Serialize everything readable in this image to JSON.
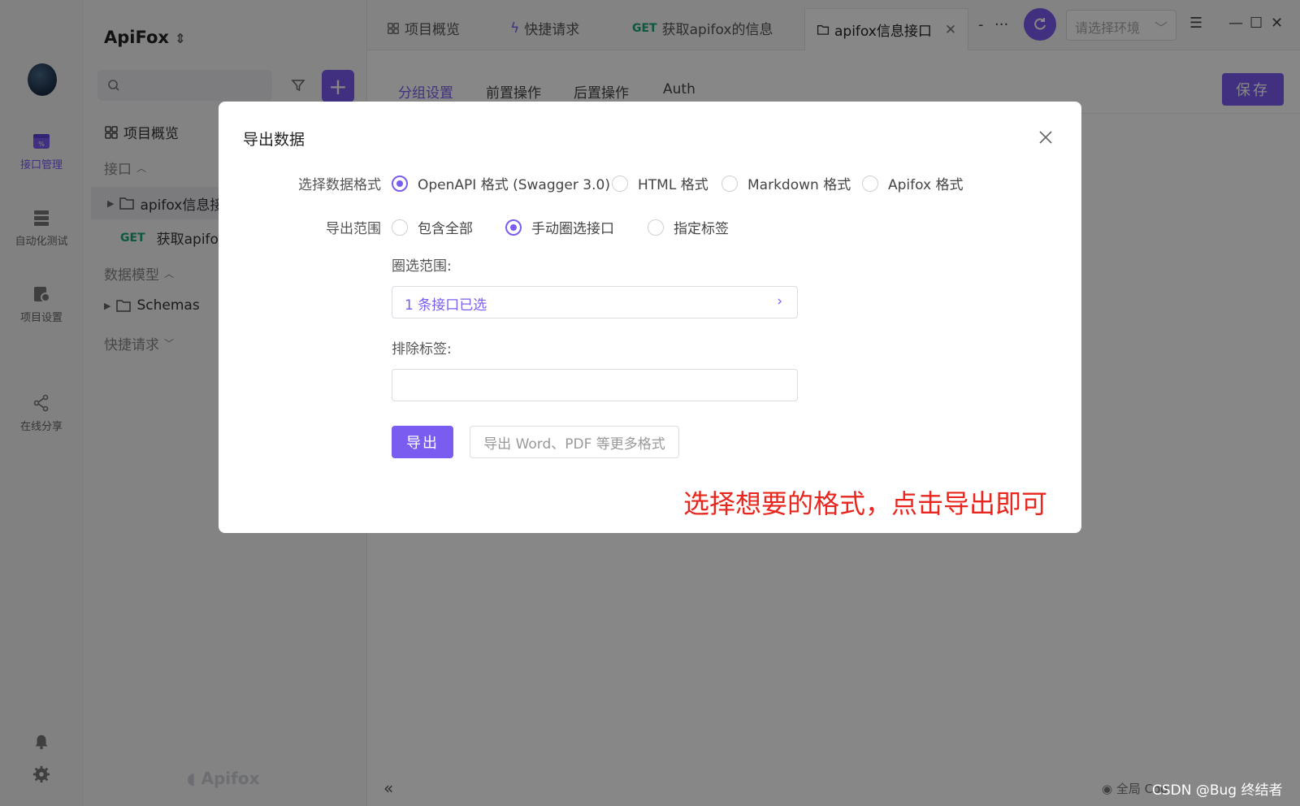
{
  "app": {
    "project_name": "ApiFox",
    "watermark": "Apifox"
  },
  "rail": {
    "items": [
      {
        "label": "接口管理",
        "icon": "api-management-icon"
      },
      {
        "label": "自动化测试",
        "icon": "automation-test-icon"
      },
      {
        "label": "项目设置",
        "icon": "project-settings-icon"
      },
      {
        "label": "在线分享",
        "icon": "share-icon"
      }
    ]
  },
  "tree": {
    "overview": "项目概览",
    "sec_api": "接口",
    "folder": "apifox信息接",
    "endpoint_method": "GET",
    "endpoint_name": "获取apifo",
    "sec_models": "数据模型",
    "schemas": "Schemas",
    "sec_quick": "快捷请求"
  },
  "tabs": [
    {
      "label": "项目概览"
    },
    {
      "label": "快捷请求"
    },
    {
      "method": "GET",
      "label": "获取apifox的信息"
    },
    {
      "label": "apifox信息接口"
    }
  ],
  "tab_more": "···",
  "env_select": {
    "placeholder": "请选择环境"
  },
  "subtabs": [
    "分组设置",
    "前置操作",
    "后置操作",
    "Auth"
  ],
  "save_label": "保存",
  "status": {
    "text": "全局 Coo",
    "csdn": "CSDN @Bug 终结者"
  },
  "modal": {
    "title": "导出数据",
    "format_label": "选择数据格式",
    "formats": [
      "OpenAPI 格式 (Swagger 3.0)",
      "HTML 格式",
      "Markdown 格式",
      "Apifox 格式"
    ],
    "selected_format": "OpenAPI 格式 (Swagger 3.0)",
    "scope_label": "导出范围",
    "scopes": [
      "包含全部",
      "手动圈选接口",
      "指定标签"
    ],
    "selected_scope": "手动圈选接口",
    "range_label": "圈选范围:",
    "range_value": "1 条接口已选",
    "exclude_label": "排除标签:",
    "exclude_value": "",
    "export_button": "导出",
    "more_formats_button": "导出 Word、PDF 等更多格式",
    "annotation": "选择想要的格式，点击导出即可"
  },
  "colors": {
    "accent": "#7b5cf0",
    "annotation": "#e8261e",
    "get_method": "#1aa974"
  }
}
